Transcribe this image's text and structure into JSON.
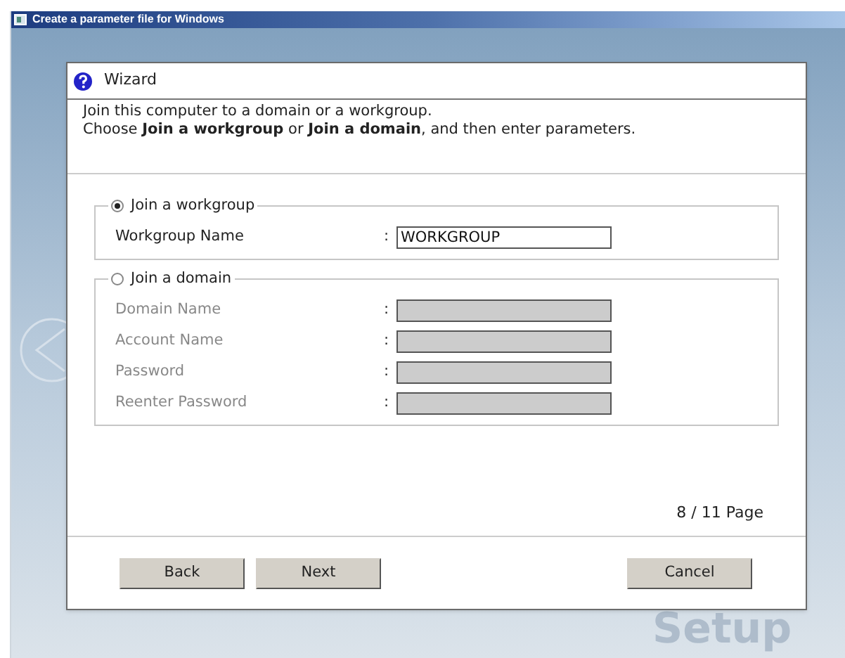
{
  "window": {
    "title": "Create a parameter file for Windows"
  },
  "background": {
    "watermark_text": "Setup"
  },
  "dialog": {
    "title": "Wizard",
    "description": [
      "Join this computer to a domain or a workgroup.",
      "Choose **Join a workgroup** or **Join a domain**, and then enter parameters."
    ],
    "groups": [
      {
        "label": "Join a workgroup",
        "selected": true,
        "fields": [
          {
            "label": "Workgroup Name",
            "separator": ":",
            "value": "WORKGROUP",
            "disabled": false
          }
        ]
      },
      {
        "label": "Join a domain",
        "selected": false,
        "fields": [
          {
            "label": "Domain Name",
            "separator": ":",
            "disabled": true
          },
          {
            "label": "Account Name",
            "separator": ":",
            "disabled": true
          },
          {
            "label": "Password",
            "separator": ":",
            "disabled": true
          },
          {
            "label": "Reenter Password",
            "separator": ":",
            "disabled": true
          }
        ]
      }
    ],
    "page_indicator": "8 / 11 Page",
    "buttons": [
      {
        "label": "Back",
        "kind": "left"
      },
      {
        "label": "Next",
        "kind": "left"
      },
      {
        "label": "Cancel",
        "kind": "right"
      }
    ]
  }
}
